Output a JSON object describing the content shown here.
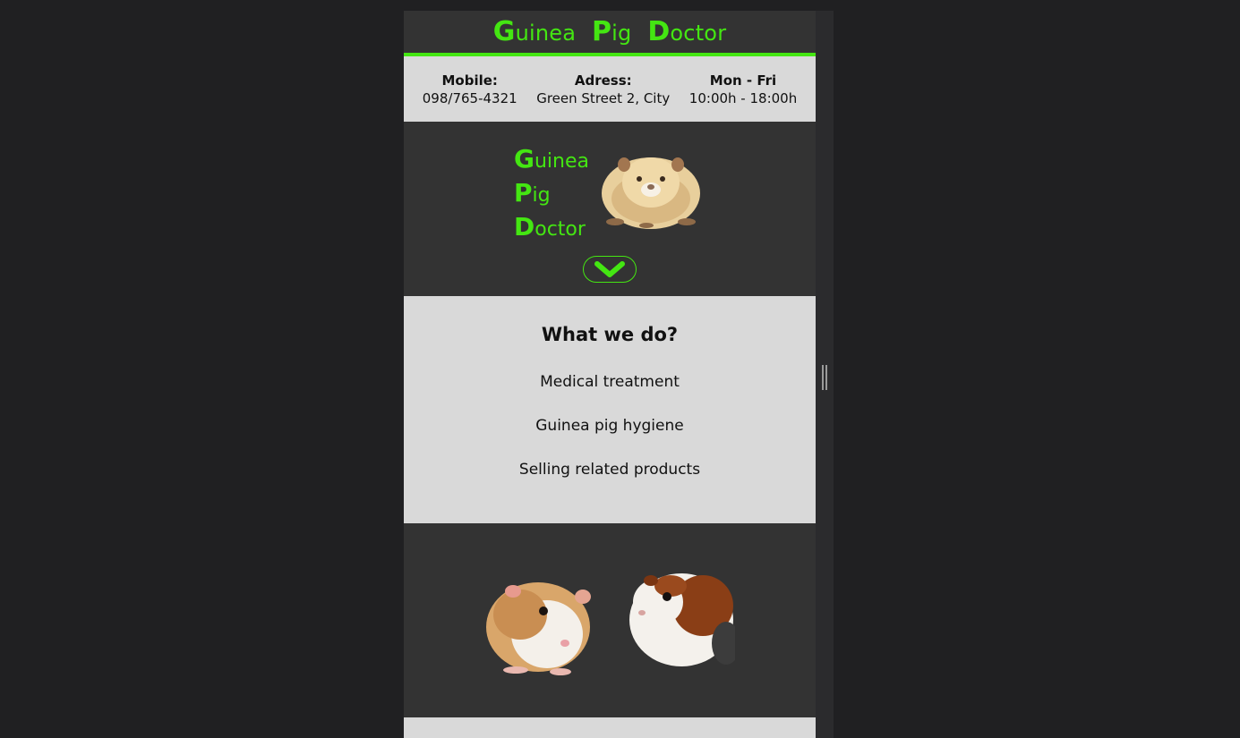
{
  "brand": {
    "words": [
      [
        "G",
        "uinea"
      ],
      [
        "P",
        "ig"
      ],
      [
        "D",
        "octor"
      ]
    ]
  },
  "info": {
    "mobile": {
      "title": "Mobile:",
      "value": "098/765-4321"
    },
    "address": {
      "title": "Adress:",
      "value": "Green Street 2, City"
    },
    "hours": {
      "title": "Mon - Fri",
      "value": "10:00h - 18:00h"
    }
  },
  "hero": {
    "scroll_icon": "chevron-down-icon"
  },
  "services": {
    "heading": "What we do?",
    "items": [
      "Medical treatment",
      "Guinea pig hygiene",
      "Selling related products"
    ]
  },
  "colors": {
    "accent": "#44e612",
    "dark": "#333333",
    "light": "#d9d9d9",
    "background": "#202022"
  }
}
